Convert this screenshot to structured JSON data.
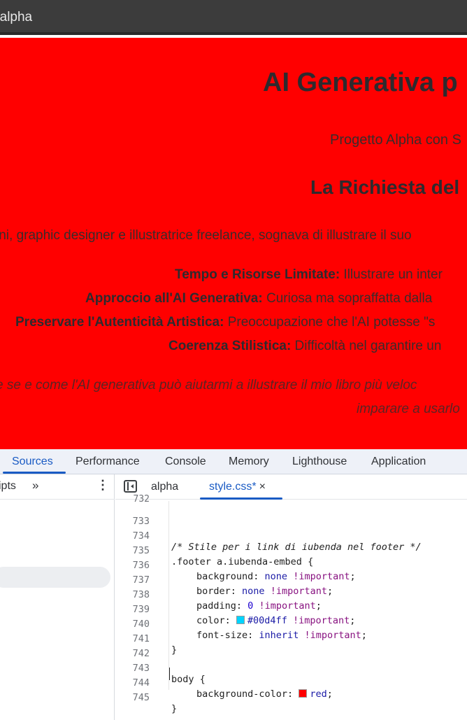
{
  "titlebar": {
    "title": "'alpha"
  },
  "page": {
    "background": "#ff0000",
    "heading": "AI Generativa p",
    "subtitle": "Progetto Alpha con S",
    "section_heading": "La Richiesta del",
    "intro": "ini, graphic designer e illustratrice freelance, sognava di illustrare il suo",
    "points": [
      {
        "label": "Tempo e Risorse Limitate:",
        "text": " Illustrare un inter"
      },
      {
        "label": "Approccio all'AI Generativa:",
        "text": " Curiosa ma sopraffatta dalla"
      },
      {
        "label": "Preservare l'Autenticità Artistica:",
        "text": " Preoccupazione che l'AI potesse \"s"
      },
      {
        "label": "Coerenza Stilistica:",
        "text": " Difficoltà nel garantire un"
      }
    ],
    "quote_line1": "e se e come l'AI generativa può aiutarmi a illustrare il mio libro più veloc",
    "quote_line2": "imparare a usarlo"
  },
  "devtools": {
    "tabs": [
      "Sources",
      "Performance",
      "Console",
      "Memory",
      "Lighthouse",
      "Application"
    ],
    "active_tab": "Sources",
    "navigator": {
      "label": "ipts",
      "more": "»",
      "menu": "⋮"
    },
    "file_tabs": [
      {
        "label": "alpha",
        "active": false
      },
      {
        "label": "style.css*",
        "active": true,
        "close": "×"
      }
    ],
    "accent": "#1a5bc4",
    "code": {
      "partial_line_number": "732",
      "lines": [
        {
          "n": "733"
        },
        {
          "n": "734"
        },
        {
          "n": "735"
        },
        {
          "n": "736"
        },
        {
          "n": "737"
        },
        {
          "n": "738"
        },
        {
          "n": "739"
        },
        {
          "n": "740"
        },
        {
          "n": "741"
        },
        {
          "n": "742"
        },
        {
          "n": "743"
        },
        {
          "n": "744"
        },
        {
          "n": "745"
        }
      ],
      "comment": "/* Stile per i link di iubenda nel footer */",
      "selector1": ".footer a.iubenda-embed {",
      "background_prop": "background:",
      "background_val": "none",
      "border_prop": "border:",
      "border_val": "none",
      "padding_prop": "padding:",
      "padding_val": "0",
      "color_prop": "color:",
      "color_val": "#00d4ff",
      "font_size_prop": "font-size:",
      "font_size_val": "inherit",
      "important": "!important",
      "semicolon": ";",
      "close_brace": "}",
      "selector2": "body {",
      "bg_color_prop": "background-color:",
      "bg_color_val": "red",
      "swatch_cyan": "#00d4ff",
      "swatch_red": "#ff0000"
    }
  }
}
